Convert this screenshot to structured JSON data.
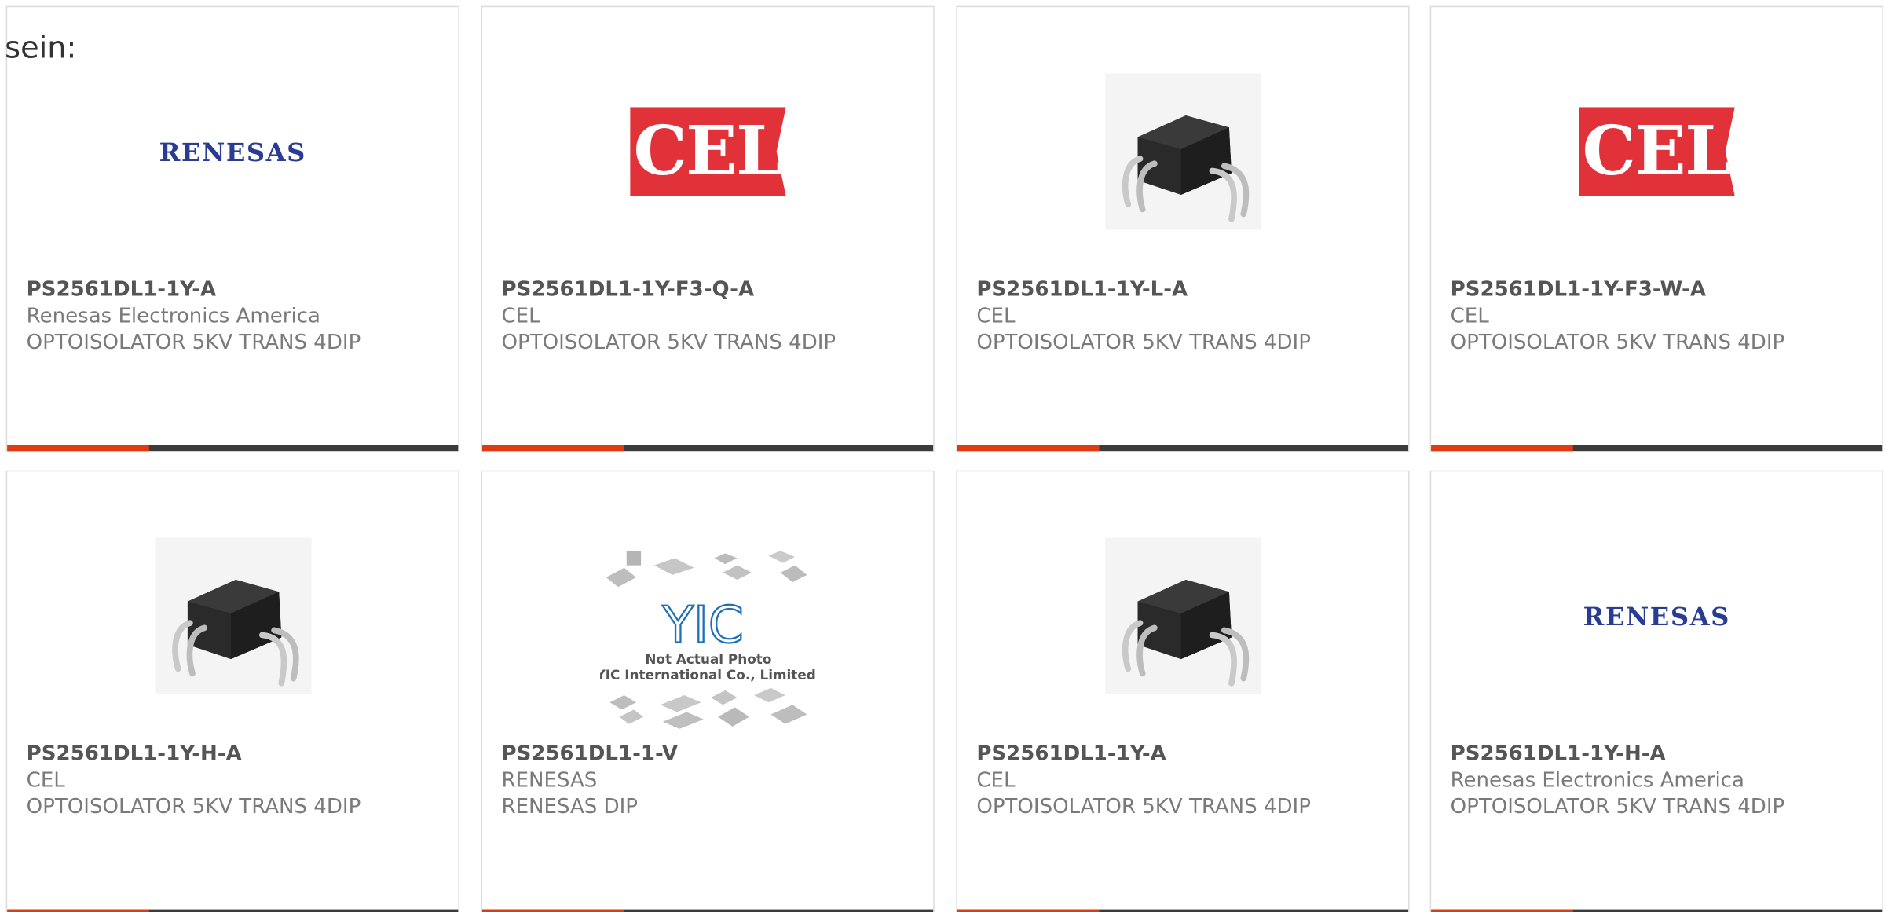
{
  "intro_text": "sein:",
  "cards": [
    {
      "part_number": "PS2561DL1-1Y-A",
      "manufacturer": "Renesas Electronics America",
      "description": "OPTOISOLATOR 5KV TRANS 4DIP",
      "image": "renesas-logo",
      "logo_text": "RENESAS"
    },
    {
      "part_number": "PS2561DL1-1Y-F3-Q-A",
      "manufacturer": "CEL",
      "description": "OPTOISOLATOR 5KV TRANS 4DIP",
      "image": "cel-logo",
      "logo_text": "CEL"
    },
    {
      "part_number": "PS2561DL1-1Y-L-A",
      "manufacturer": "CEL",
      "description": "OPTOISOLATOR 5KV TRANS 4DIP",
      "image": "dip-chip-photo"
    },
    {
      "part_number": "PS2561DL1-1Y-F3-W-A",
      "manufacturer": "CEL",
      "description": "OPTOISOLATOR 5KV TRANS 4DIP",
      "image": "cel-logo",
      "logo_text": "CEL"
    },
    {
      "part_number": "PS2561DL1-1Y-H-A",
      "manufacturer": "CEL",
      "description": "OPTOISOLATOR 5KV TRANS 4DIP",
      "image": "dip-chip-photo"
    },
    {
      "part_number": "PS2561DL1-1-V",
      "manufacturer": "RENESAS",
      "description": "RENESAS DIP",
      "image": "not-actual-photo",
      "logo_text": "YIC",
      "caption_line1": "Not Actual Photo",
      "caption_line2": "YIC International Co., Limited."
    },
    {
      "part_number": "PS2561DL1-1Y-A",
      "manufacturer": "CEL",
      "description": "OPTOISOLATOR 5KV TRANS 4DIP",
      "image": "dip-chip-photo"
    },
    {
      "part_number": "PS2561DL1-1Y-H-A",
      "manufacturer": "Renesas Electronics America",
      "description": "OPTOISOLATOR 5KV TRANS 4DIP",
      "image": "renesas-logo",
      "logo_text": "RENESAS"
    }
  ],
  "colors": {
    "accent": "#e03a12",
    "bar": "#3b3b3b",
    "renesas_blue": "#2a3b93",
    "cel_red": "#e23239",
    "yic_blue": "#1f6fb8"
  }
}
